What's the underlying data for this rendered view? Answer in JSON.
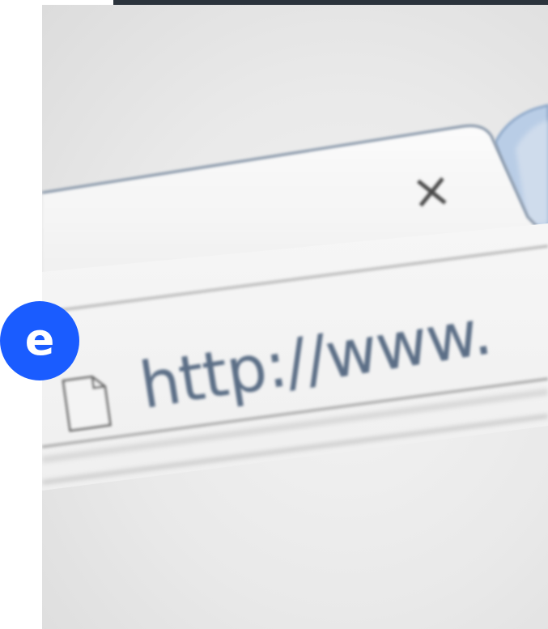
{
  "browser": {
    "address_bar": {
      "url_text": "http://www."
    },
    "tab": {
      "close_glyph": "×"
    }
  },
  "brand": {
    "logo_letter": "e",
    "color": "#1a5cff"
  },
  "colors": {
    "tab_blue": "#b9cde6",
    "frame_dark": "#2b333c"
  }
}
